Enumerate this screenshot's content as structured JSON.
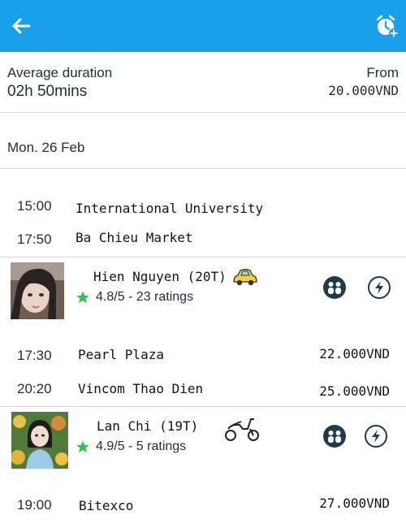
{
  "header": {
    "back_icon": "arrow-left-icon",
    "alarm_icon": "alarm-add-icon",
    "color": "#1aa0ea"
  },
  "summary": {
    "duration_label": "Average duration",
    "duration_value": "02h 50mins",
    "from_label": "From",
    "from_value": "20.000VND"
  },
  "day": "Mon. 26 Feb",
  "trip1": {
    "stops": [
      {
        "time": "15:00",
        "place": "International University"
      },
      {
        "time": "17:50",
        "place": "Ba Chieu Market"
      }
    ]
  },
  "driver1": {
    "name": "Hien Nguyen (20T)",
    "rating": "4.8/5 - 23 ratings",
    "vehicle": "car-icon"
  },
  "trip2": {
    "stops": [
      {
        "time": "17:30",
        "place": "Pearl Plaza",
        "price": "22.000VND"
      },
      {
        "time": "20:20",
        "place": "Vincom Thao Dien",
        "price": "25.000VND"
      }
    ]
  },
  "driver2": {
    "name": "Lan Chi (19T)",
    "rating": "4.9/5 - 5 ratings",
    "vehicle": "scooter-icon"
  },
  "trip3": {
    "stops": [
      {
        "time": "19:00",
        "place": "Bitexco",
        "price": "27.000VND"
      }
    ]
  },
  "colors": {
    "star": "#3dbb5c",
    "icon_dark": "#1f3a4b",
    "car": "#f5cf3c"
  }
}
